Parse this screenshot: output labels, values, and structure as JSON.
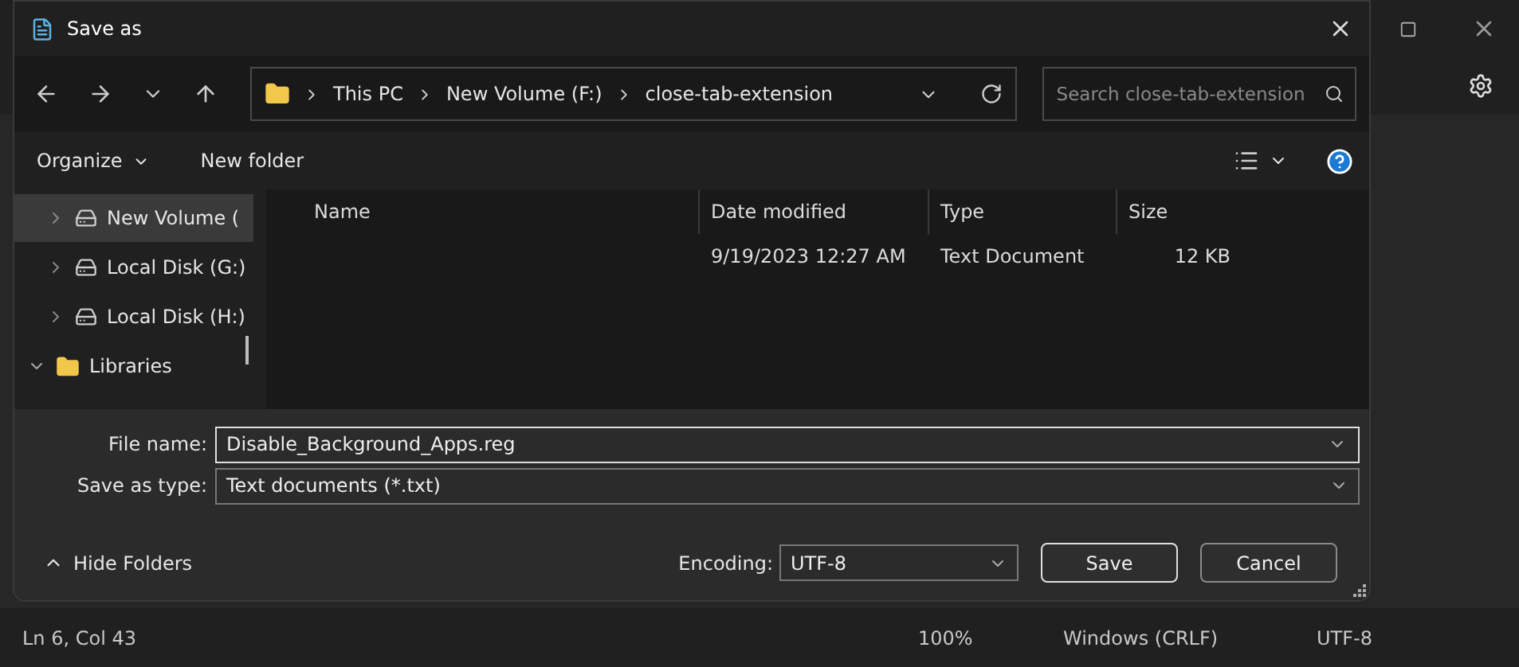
{
  "dialog": {
    "title": "Save as",
    "breadcrumb": [
      "This PC",
      "New Volume (F:)",
      "close-tab-extension"
    ],
    "search": {
      "placeholder": "Search close-tab-extension"
    },
    "toolbar": {
      "organize": "Organize",
      "new_folder": "New folder"
    },
    "sidebar": {
      "items": [
        {
          "label": "New Volume (",
          "kind": "drive",
          "expanded": false,
          "selected": true
        },
        {
          "label": "Local Disk (G:)",
          "kind": "drive",
          "expanded": false,
          "selected": false
        },
        {
          "label": "Local Disk (H:)",
          "kind": "drive",
          "expanded": false,
          "selected": false
        },
        {
          "label": "Libraries",
          "kind": "folder",
          "expanded": true,
          "selected": false
        }
      ]
    },
    "table": {
      "columns": [
        "Name",
        "Date modified",
        "Type",
        "Size"
      ],
      "rows": [
        {
          "date_modified": "9/19/2023 12:27 AM",
          "type": "Text Document",
          "size": "12 KB"
        }
      ]
    },
    "file_name": {
      "label": "File name:",
      "value": "Disable_Background_Apps.reg"
    },
    "save_as_type": {
      "label": "Save as type:",
      "value": "Text documents (*.txt)"
    },
    "hide_folders": "Hide Folders",
    "encoding": {
      "label": "Encoding:",
      "value": "UTF-8"
    },
    "buttons": [
      "Save",
      "Cancel"
    ]
  },
  "status_bar": [
    "Ln 6, Col 43",
    "100%",
    "Windows (CRLF)",
    "UTF-8"
  ]
}
